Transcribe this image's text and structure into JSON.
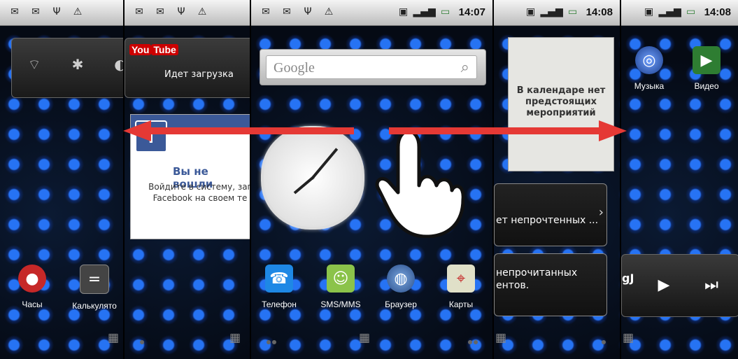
{
  "status_bar": {
    "times": [
      "14:07",
      "14:08",
      "14:08"
    ]
  },
  "widgets": {
    "youtube_logo": "You",
    "youtube_logo_box": "Tube",
    "youtube_status": "Идет загрузка",
    "facebook_title": "Вы не вошли",
    "facebook_text": "Войдите в систему, заг Facebook на своем те",
    "google_search": "Google",
    "calendar": "В календаре нет предстоящих мероприятий",
    "message1": "ет непрочтенных ...",
    "message2": "непрочитанных\nентов."
  },
  "apps": {
    "panel1": [
      {
        "label": "Часы"
      },
      {
        "label": "Калькулято"
      }
    ],
    "panel3": [
      {
        "label": "Телефон"
      },
      {
        "label": "SMS/MMS"
      },
      {
        "label": "Браузер"
      },
      {
        "label": "Карты"
      }
    ],
    "panel5": [
      {
        "label": "Музыка"
      },
      {
        "label": "Видео"
      }
    ]
  },
  "music_player": {
    "label": "gJ"
  },
  "colors": {
    "arrow": "#e53935",
    "facebook": "#3b5998"
  }
}
